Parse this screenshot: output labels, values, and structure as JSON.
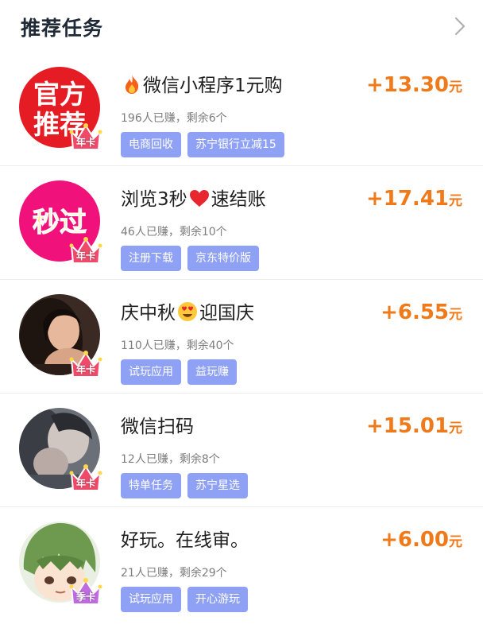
{
  "header": {
    "title": "推荐任务"
  },
  "tasks": [
    {
      "title_pre": "",
      "title_emoji": "fire-icon",
      "title_post": "微信小程序1元购",
      "stats": "196人已赚，剩余6个",
      "tags": [
        "电商回收",
        "苏宁银行立减15"
      ],
      "reward_amount": "+13.30",
      "reward_unit": "元",
      "avatar_text_1": "官方",
      "avatar_text_2": "推荐",
      "badge": "年卡"
    },
    {
      "title_pre": "浏览3秒",
      "title_emoji": "heart-icon",
      "title_post": "速结账",
      "stats": "46人已赚，剩余10个",
      "tags": [
        "注册下载",
        "京东特价版"
      ],
      "reward_amount": "+17.41",
      "reward_unit": "元",
      "avatar_text_1": "秒过",
      "badge": "年卡"
    },
    {
      "title_pre": "庆中秋",
      "title_emoji": "heart-eyes-emoji-icon",
      "title_post": "迎国庆",
      "stats": "110人已赚，剩余40个",
      "tags": [
        "试玩应用",
        "益玩赚"
      ],
      "reward_amount": "+6.55",
      "reward_unit": "元",
      "badge": "年卡"
    },
    {
      "title_pre": "微信扫码",
      "title_emoji": "",
      "title_post": "",
      "stats": "12人已赚，剩余8个",
      "tags": [
        "特单任务",
        "苏宁星选"
      ],
      "reward_amount": "+15.01",
      "reward_unit": "元",
      "badge": "年卡"
    },
    {
      "title_pre": "好玩。在线审。",
      "title_emoji": "",
      "title_post": "",
      "stats": "21人已赚，剩余29个",
      "tags": [
        "试玩应用",
        "开心游玩"
      ],
      "reward_amount": "+6.00",
      "reward_unit": "元",
      "badge": "季卡"
    }
  ],
  "colors": {
    "accent_orange": "#f07a1a",
    "tag_blue": "#8fa1f5",
    "crown_pink": "#f04a6a",
    "crown_purple": "#c06ae0"
  }
}
